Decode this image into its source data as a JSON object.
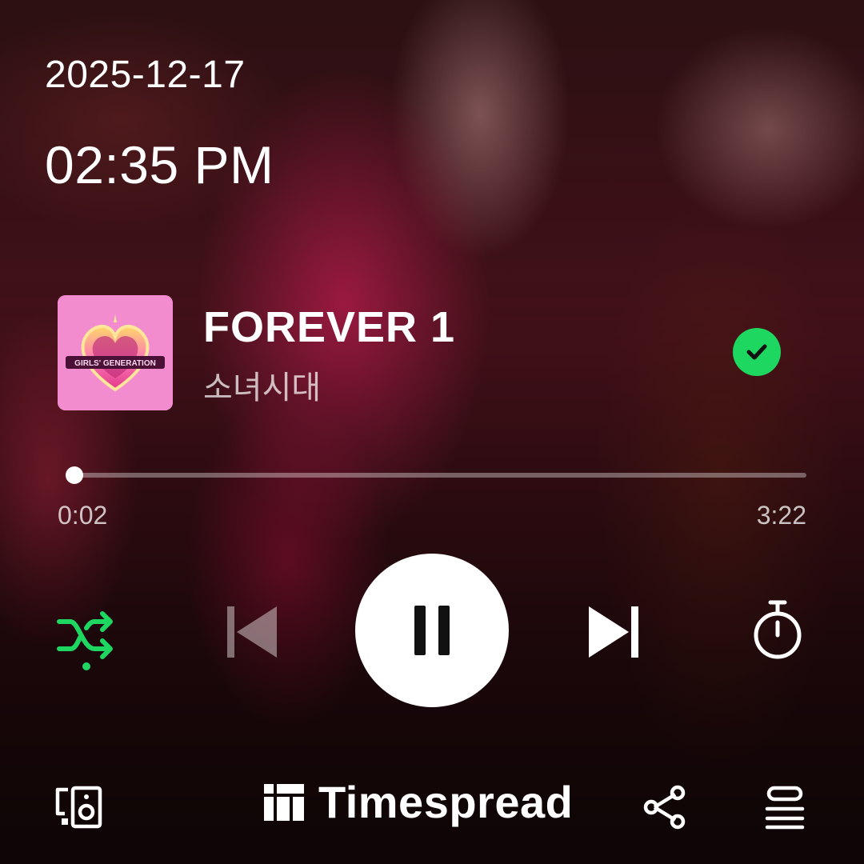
{
  "status": {
    "date": "2025-12-17",
    "time": "02:35 PM"
  },
  "track": {
    "title": "FOREVER 1",
    "artist": "소녀시대",
    "album_art_text": "GIRLS' GENERATION",
    "saved": true
  },
  "playback": {
    "elapsed": "0:02",
    "duration": "3:22",
    "progress_fraction": 0.01,
    "is_playing": true,
    "shuffle_on": true
  },
  "footer": {
    "brand": "Timespread"
  },
  "colors": {
    "accent": "#1ed760",
    "text": "#ffffff",
    "muted": "rgba(255,255,255,0.72)"
  },
  "icons": {
    "saved": "check-icon",
    "shuffle": "shuffle-icon",
    "previous": "skip-previous-icon",
    "play_pause": "pause-icon",
    "next": "skip-next-icon",
    "timer": "sleep-timer-icon",
    "devices": "connect-device-icon",
    "brand": "timespread-logo-icon",
    "share": "share-icon",
    "queue": "queue-icon"
  }
}
